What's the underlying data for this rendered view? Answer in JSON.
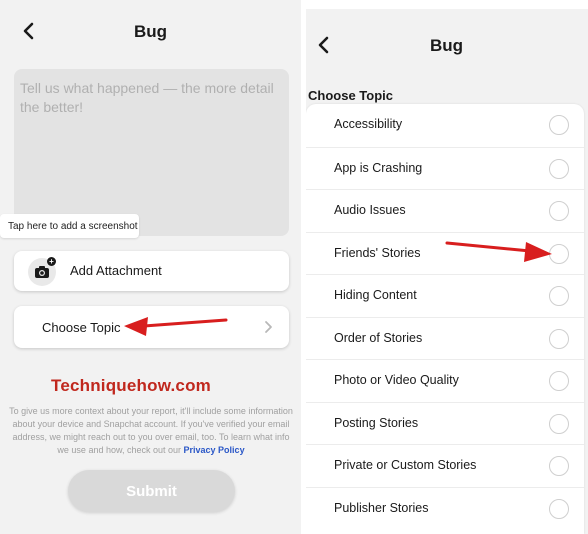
{
  "left": {
    "title": "Bug",
    "description_placeholder": "Tell us what happened — the more detail the better!",
    "screenshot_tooltip": "Tap here to add a screenshot",
    "attachment_label": "Add Attachment",
    "choose_topic_label": "Choose Topic",
    "watermark": "Techniquehow.com",
    "info_text": "To give us more context about your report, it'll include some information about your device and Snapchat account. If you've verified your email address, we might reach out to you over email, too. To learn what info we use and how, check out our",
    "privacy_link": "Privacy Policy",
    "submit_label": "Submit"
  },
  "right": {
    "title": "Bug",
    "section_header": "Choose Topic",
    "topics": [
      "Accessibility",
      "App is Crashing",
      "Audio Issues",
      "Friends' Stories",
      "Hiding Content",
      "Order of Stories",
      "Photo or Video Quality",
      "Posting Stories",
      "Private or Custom Stories",
      "Publisher Stories"
    ]
  },
  "colors": {
    "annotation_arrow": "#d81e1e",
    "watermark": "#c0281e",
    "link": "#2a57c7",
    "submit_disabled": "#d9d9d9"
  },
  "icons": [
    "back-chevron-icon",
    "camera-icon",
    "chevron-right-icon",
    "radio-unchecked-icon",
    "red-arrow-annotation"
  ]
}
